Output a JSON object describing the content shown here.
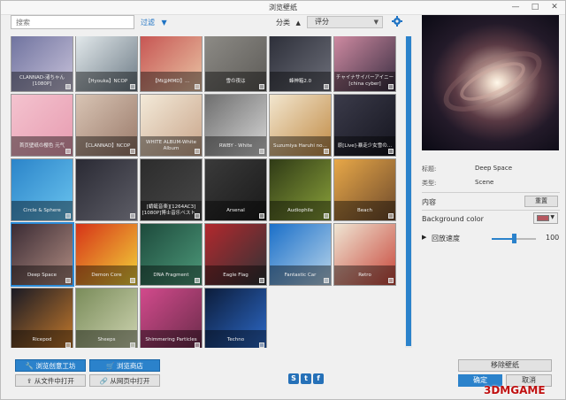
{
  "window": {
    "title": "浏览壁纸",
    "minimize": "—",
    "maximize": "□",
    "close": "✕"
  },
  "toolbar": {
    "search_placeholder": "搜索",
    "filter_label": "过滤",
    "sort_label": "分类",
    "sort_value": "评分"
  },
  "wallpapers": [
    {
      "title": "CLANNAD-渚ちゃん [1080P]",
      "colors": [
        "#6b6f9c",
        "#c8c2da"
      ]
    },
    {
      "title": "【Hyouka】NCOP",
      "colors": [
        "#e8eef0",
        "#6d7b86"
      ]
    },
    {
      "title": "【Mi@MMD】…",
      "colors": [
        "#c5504f",
        "#e9c4a4"
      ]
    },
    {
      "title": "雪の夜は",
      "colors": [
        "#8f8d88",
        "#5d5b57"
      ]
    },
    {
      "title": "蜂神箱2.0",
      "colors": [
        "#2a2c36",
        "#6d6f7a"
      ]
    },
    {
      "title": "チャイナサイバーアイニー[china cyber]",
      "colors": [
        "#d68fa6",
        "#3a2e42"
      ]
    },
    {
      "title": "首页壁纸の樱色 元气",
      "colors": [
        "#f4c3cf",
        "#e79bb0"
      ]
    },
    {
      "title": "【CLANNAD】NCOP",
      "colors": [
        "#d8c4b4",
        "#9a7a6a"
      ]
    },
    {
      "title": "WHITE ALBUM-White Album",
      "colors": [
        "#f3ead9",
        "#c9a58a"
      ]
    },
    {
      "title": "RWBY - White",
      "colors": [
        "#6e6e6e",
        "#d7d7d7"
      ]
    },
    {
      "title": "Suzumiya Haruhi no…",
      "colors": [
        "#f2e6cf",
        "#c18b45"
      ]
    },
    {
      "title": "原[Live]-暴走少女雪の…",
      "colors": [
        "#3b3b4a",
        "#15151f"
      ]
    },
    {
      "title": "Circle & Sphere",
      "colors": [
        "#2b84c9",
        "#6ac4ef"
      ]
    },
    {
      "title": "",
      "colors": [
        "#2a2a34",
        "#5d5d66"
      ]
    },
    {
      "title": "[蜻蜓音楽][1264AC3][1080P]博士音乐ベスト…",
      "colors": [
        "#2c2c2c",
        "#484848"
      ]
    },
    {
      "title": "Arsenal",
      "colors": [
        "#3a3a3a",
        "#1a1a1a"
      ]
    },
    {
      "title": "Audiophile",
      "colors": [
        "#2f3a16",
        "#8aa13a"
      ]
    },
    {
      "title": "Beach",
      "colors": [
        "#e8a848",
        "#6e4a2c"
      ]
    },
    {
      "title": "Deep Space",
      "colors": [
        "#3a2b34",
        "#b28d82"
      ]
    },
    {
      "title": "Demon Core",
      "colors": [
        "#d63318",
        "#f2d43a"
      ]
    },
    {
      "title": "DNA Fragment",
      "colors": [
        "#1d4a3c",
        "#4d9a7a"
      ]
    },
    {
      "title": "Eagle Flag",
      "colors": [
        "#b3282d",
        "#2f3336"
      ]
    },
    {
      "title": "Fantastic Car",
      "colors": [
        "#1a6fc9",
        "#b9d5ea"
      ]
    },
    {
      "title": "Retro",
      "colors": [
        "#efe6d4",
        "#c8463a"
      ]
    },
    {
      "title": "Ricepod",
      "colors": [
        "#1a1a24",
        "#c57a2c"
      ]
    },
    {
      "title": "Sheeps",
      "colors": [
        "#7a8c5a",
        "#cfd5b2"
      ]
    },
    {
      "title": "Shimmering Particles",
      "colors": [
        "#d24a8c",
        "#6a2c4a"
      ]
    },
    {
      "title": "Techno",
      "colors": [
        "#0c1c3a",
        "#2d6ac9"
      ]
    }
  ],
  "selected_index": 18,
  "details": {
    "title_label": "标题:",
    "title_value": "Deep Space",
    "type_label": "类型:",
    "type_value": "Scene",
    "properties_label": "内容",
    "reset_label": "重置",
    "bgcolor_label": "Background color",
    "bgcolor_value": "#b5575f",
    "speed_label": "回放速度",
    "speed_value": "100",
    "speed_level": 0.5
  },
  "bottom": {
    "workshop_label": "浏览创意工坊",
    "store_label": "浏览商店",
    "open_file_label": "从文件中打开",
    "open_web_label": "从网页中打开",
    "social_icons": [
      "steam-icon",
      "twitter-icon",
      "facebook-icon"
    ],
    "remove_label": "移除壁纸",
    "ok_label": "确定",
    "cancel_label": "取消"
  },
  "watermark": "3DMGAME"
}
